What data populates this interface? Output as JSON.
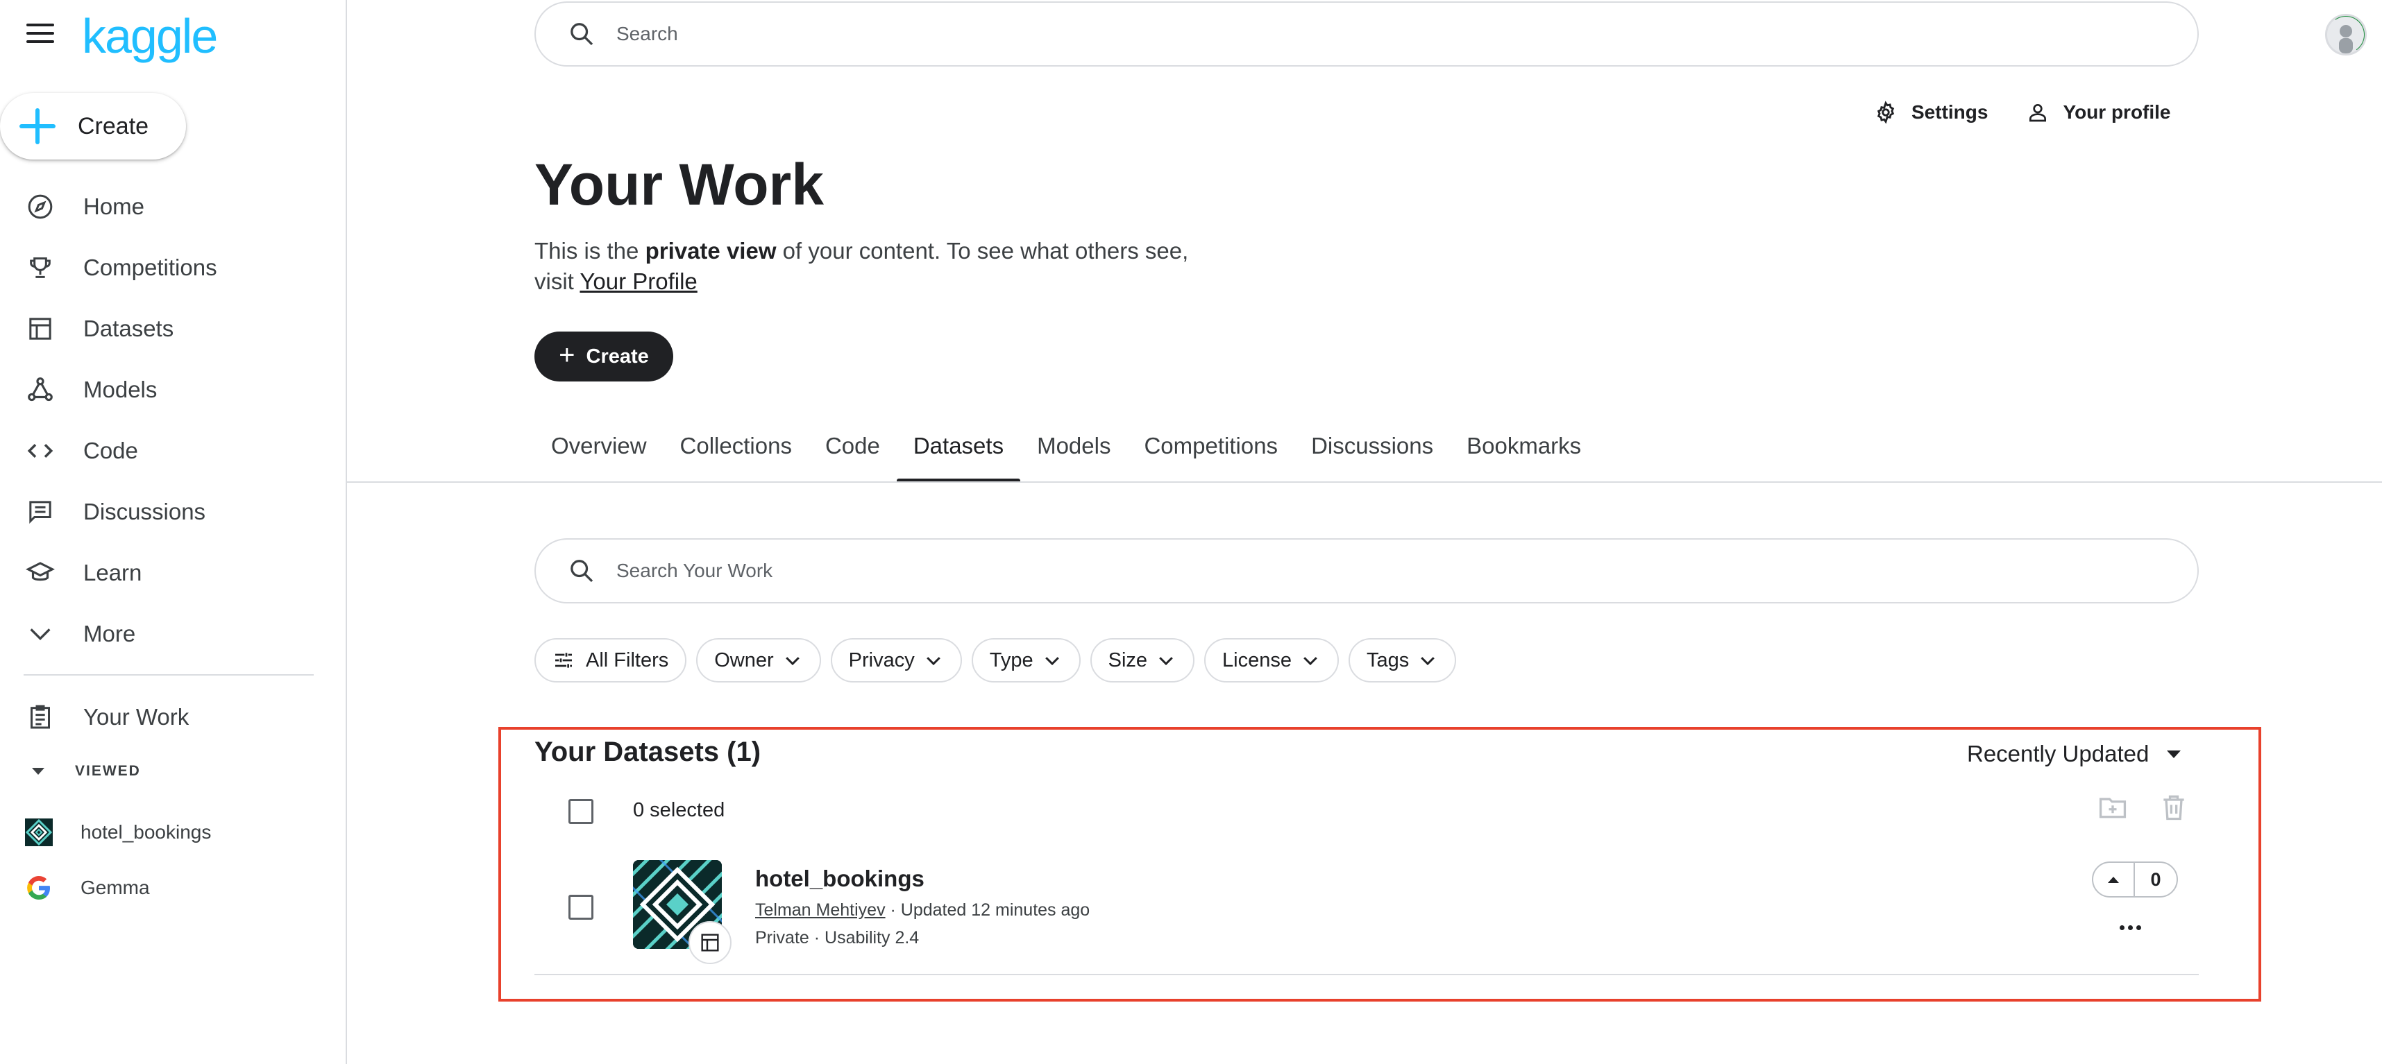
{
  "brand": {
    "logo_text": "kaggle",
    "accent": "#20beff"
  },
  "sidebar": {
    "create_label": "Create",
    "items": [
      {
        "label": "Home",
        "icon": "compass-icon"
      },
      {
        "label": "Competitions",
        "icon": "trophy-icon"
      },
      {
        "label": "Datasets",
        "icon": "table-icon"
      },
      {
        "label": "Models",
        "icon": "models-icon"
      },
      {
        "label": "Code",
        "icon": "code-icon"
      },
      {
        "label": "Discussions",
        "icon": "discussion-icon"
      },
      {
        "label": "Learn",
        "icon": "graduation-cap-icon"
      },
      {
        "label": "More",
        "icon": "chevron-down-icon"
      }
    ],
    "your_work": "Your Work",
    "viewed_header": "VIEWED",
    "viewed": [
      {
        "label": "hotel_bookings",
        "icon": "dataset-thumb-icon"
      },
      {
        "label": "Gemma",
        "icon": "google-g-icon"
      }
    ]
  },
  "header": {
    "search_placeholder": "Search",
    "settings_label": "Settings",
    "profile_label": "Your profile"
  },
  "page": {
    "title": "Your Work",
    "desc_before": "This is the ",
    "desc_bold": "private view",
    "desc_after": " of your content. To see what others see, visit ",
    "desc_link": "Your Profile",
    "create_label": "Create"
  },
  "tabs": [
    "Overview",
    "Collections",
    "Code",
    "Datasets",
    "Models",
    "Competitions",
    "Discussions",
    "Bookmarks"
  ],
  "active_tab": "Datasets",
  "work_search_placeholder": "Search Your Work",
  "filters": [
    "All Filters",
    "Owner",
    "Privacy",
    "Type",
    "Size",
    "License",
    "Tags"
  ],
  "datasets": {
    "title": "Your Datasets (1)",
    "sort_label": "Recently Updated",
    "selected_label": "0 selected",
    "items": [
      {
        "name": "hotel_bookings",
        "owner": "Telman Mehtiyev",
        "updated": " · Updated 12 minutes ago",
        "meta": "Private · Usability 2.4",
        "votes": "0"
      }
    ]
  },
  "colors": {
    "highlight_box": "#e8412c",
    "text": "#202124",
    "border": "#dadce0"
  }
}
